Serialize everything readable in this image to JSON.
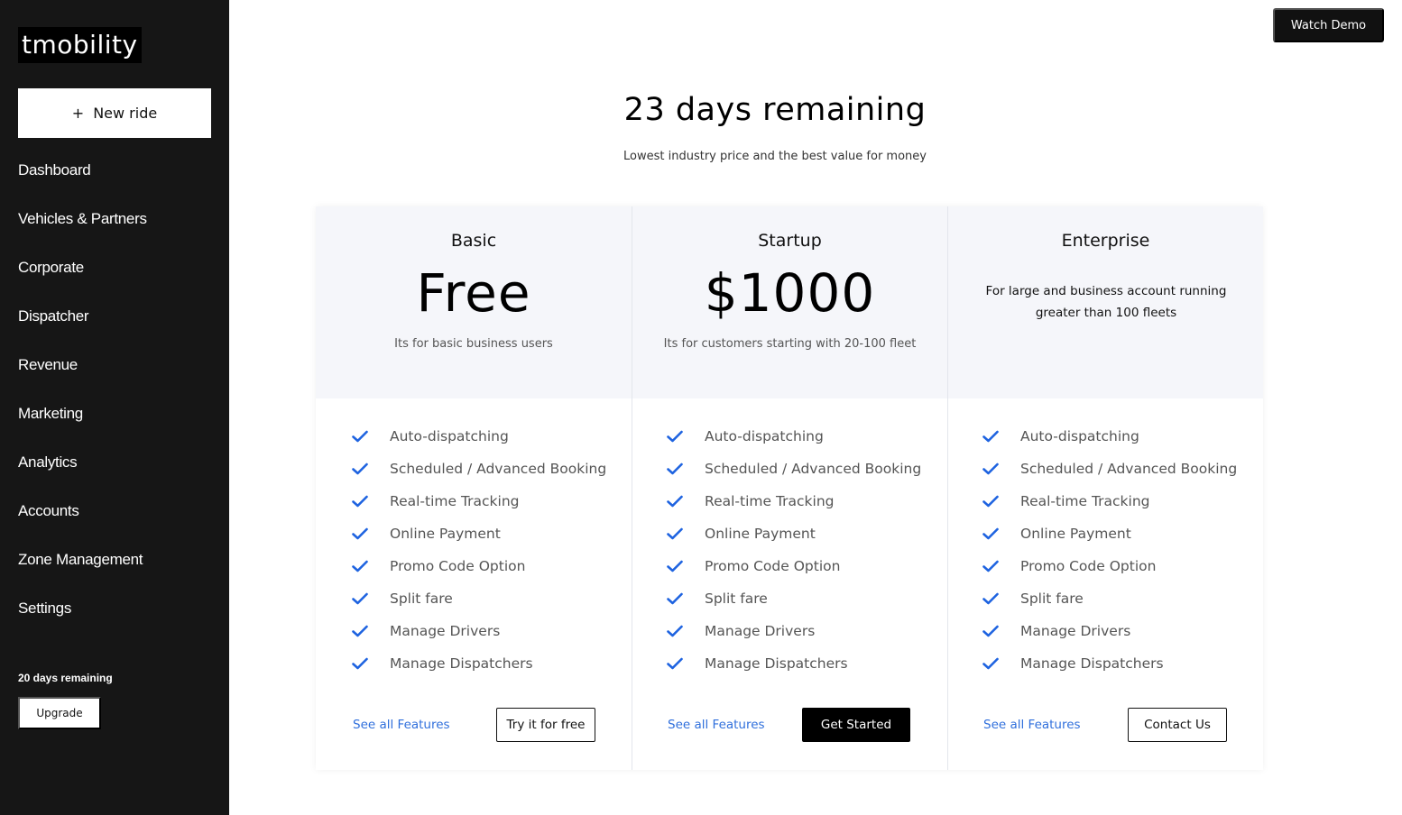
{
  "sidebar": {
    "logo": "tmobility",
    "new_ride_icon": "plus-icon",
    "new_ride_label": "New ride",
    "nav": [
      {
        "label": "Dashboard"
      },
      {
        "label": "Vehicles & Partners"
      },
      {
        "label": "Corporate"
      },
      {
        "label": "Dispatcher"
      },
      {
        "label": "Revenue"
      },
      {
        "label": "Marketing"
      },
      {
        "label": "Analytics"
      },
      {
        "label": "Accounts"
      },
      {
        "label": "Zone Management"
      },
      {
        "label": "Settings"
      }
    ],
    "trial_text": "20 days remaining",
    "upgrade_label": "Upgrade"
  },
  "header": {
    "watch_demo_label": "Watch Demo"
  },
  "main": {
    "headline": "23 days remaining",
    "subheadline": "Lowest industry price and the best value for money",
    "plans": [
      {
        "name": "Basic",
        "price": "Free",
        "description": "Its for basic business users",
        "features": [
          "Auto-dispatching",
          "Scheduled / Advanced Booking",
          "Real-time Tracking",
          "Online Payment",
          "Promo Code Option",
          "Split fare",
          "Manage Drivers",
          "Manage Dispatchers"
        ],
        "see_all_label": "See all Features",
        "cta_label": "Try it for free"
      },
      {
        "name": "Startup",
        "price": "$1000",
        "description": "Its for customers starting with 20-100 fleet",
        "features": [
          "Auto-dispatching",
          "Scheduled / Advanced Booking",
          "Real-time Tracking",
          "Online Payment",
          "Promo Code Option",
          "Split fare",
          "Manage Drivers",
          "Manage Dispatchers"
        ],
        "see_all_label": "See all Features",
        "cta_label": "Get Started"
      },
      {
        "name": "Enterprise",
        "description": "For large and business account running greater than 100 fleets",
        "features": [
          "Auto-dispatching",
          "Scheduled / Advanced Booking",
          "Real-time Tracking",
          "Online Payment",
          "Promo Code Option",
          "Split fare",
          "Manage Drivers",
          "Manage Dispatchers"
        ],
        "see_all_label": "See all Features",
        "cta_label": "Contact Us"
      }
    ]
  },
  "colors": {
    "sidebar_bg": "#161616",
    "accent_blue": "#2f6fdc",
    "plan_header_bg": "#f5f6fa",
    "check_icon": "#1e63e0"
  }
}
